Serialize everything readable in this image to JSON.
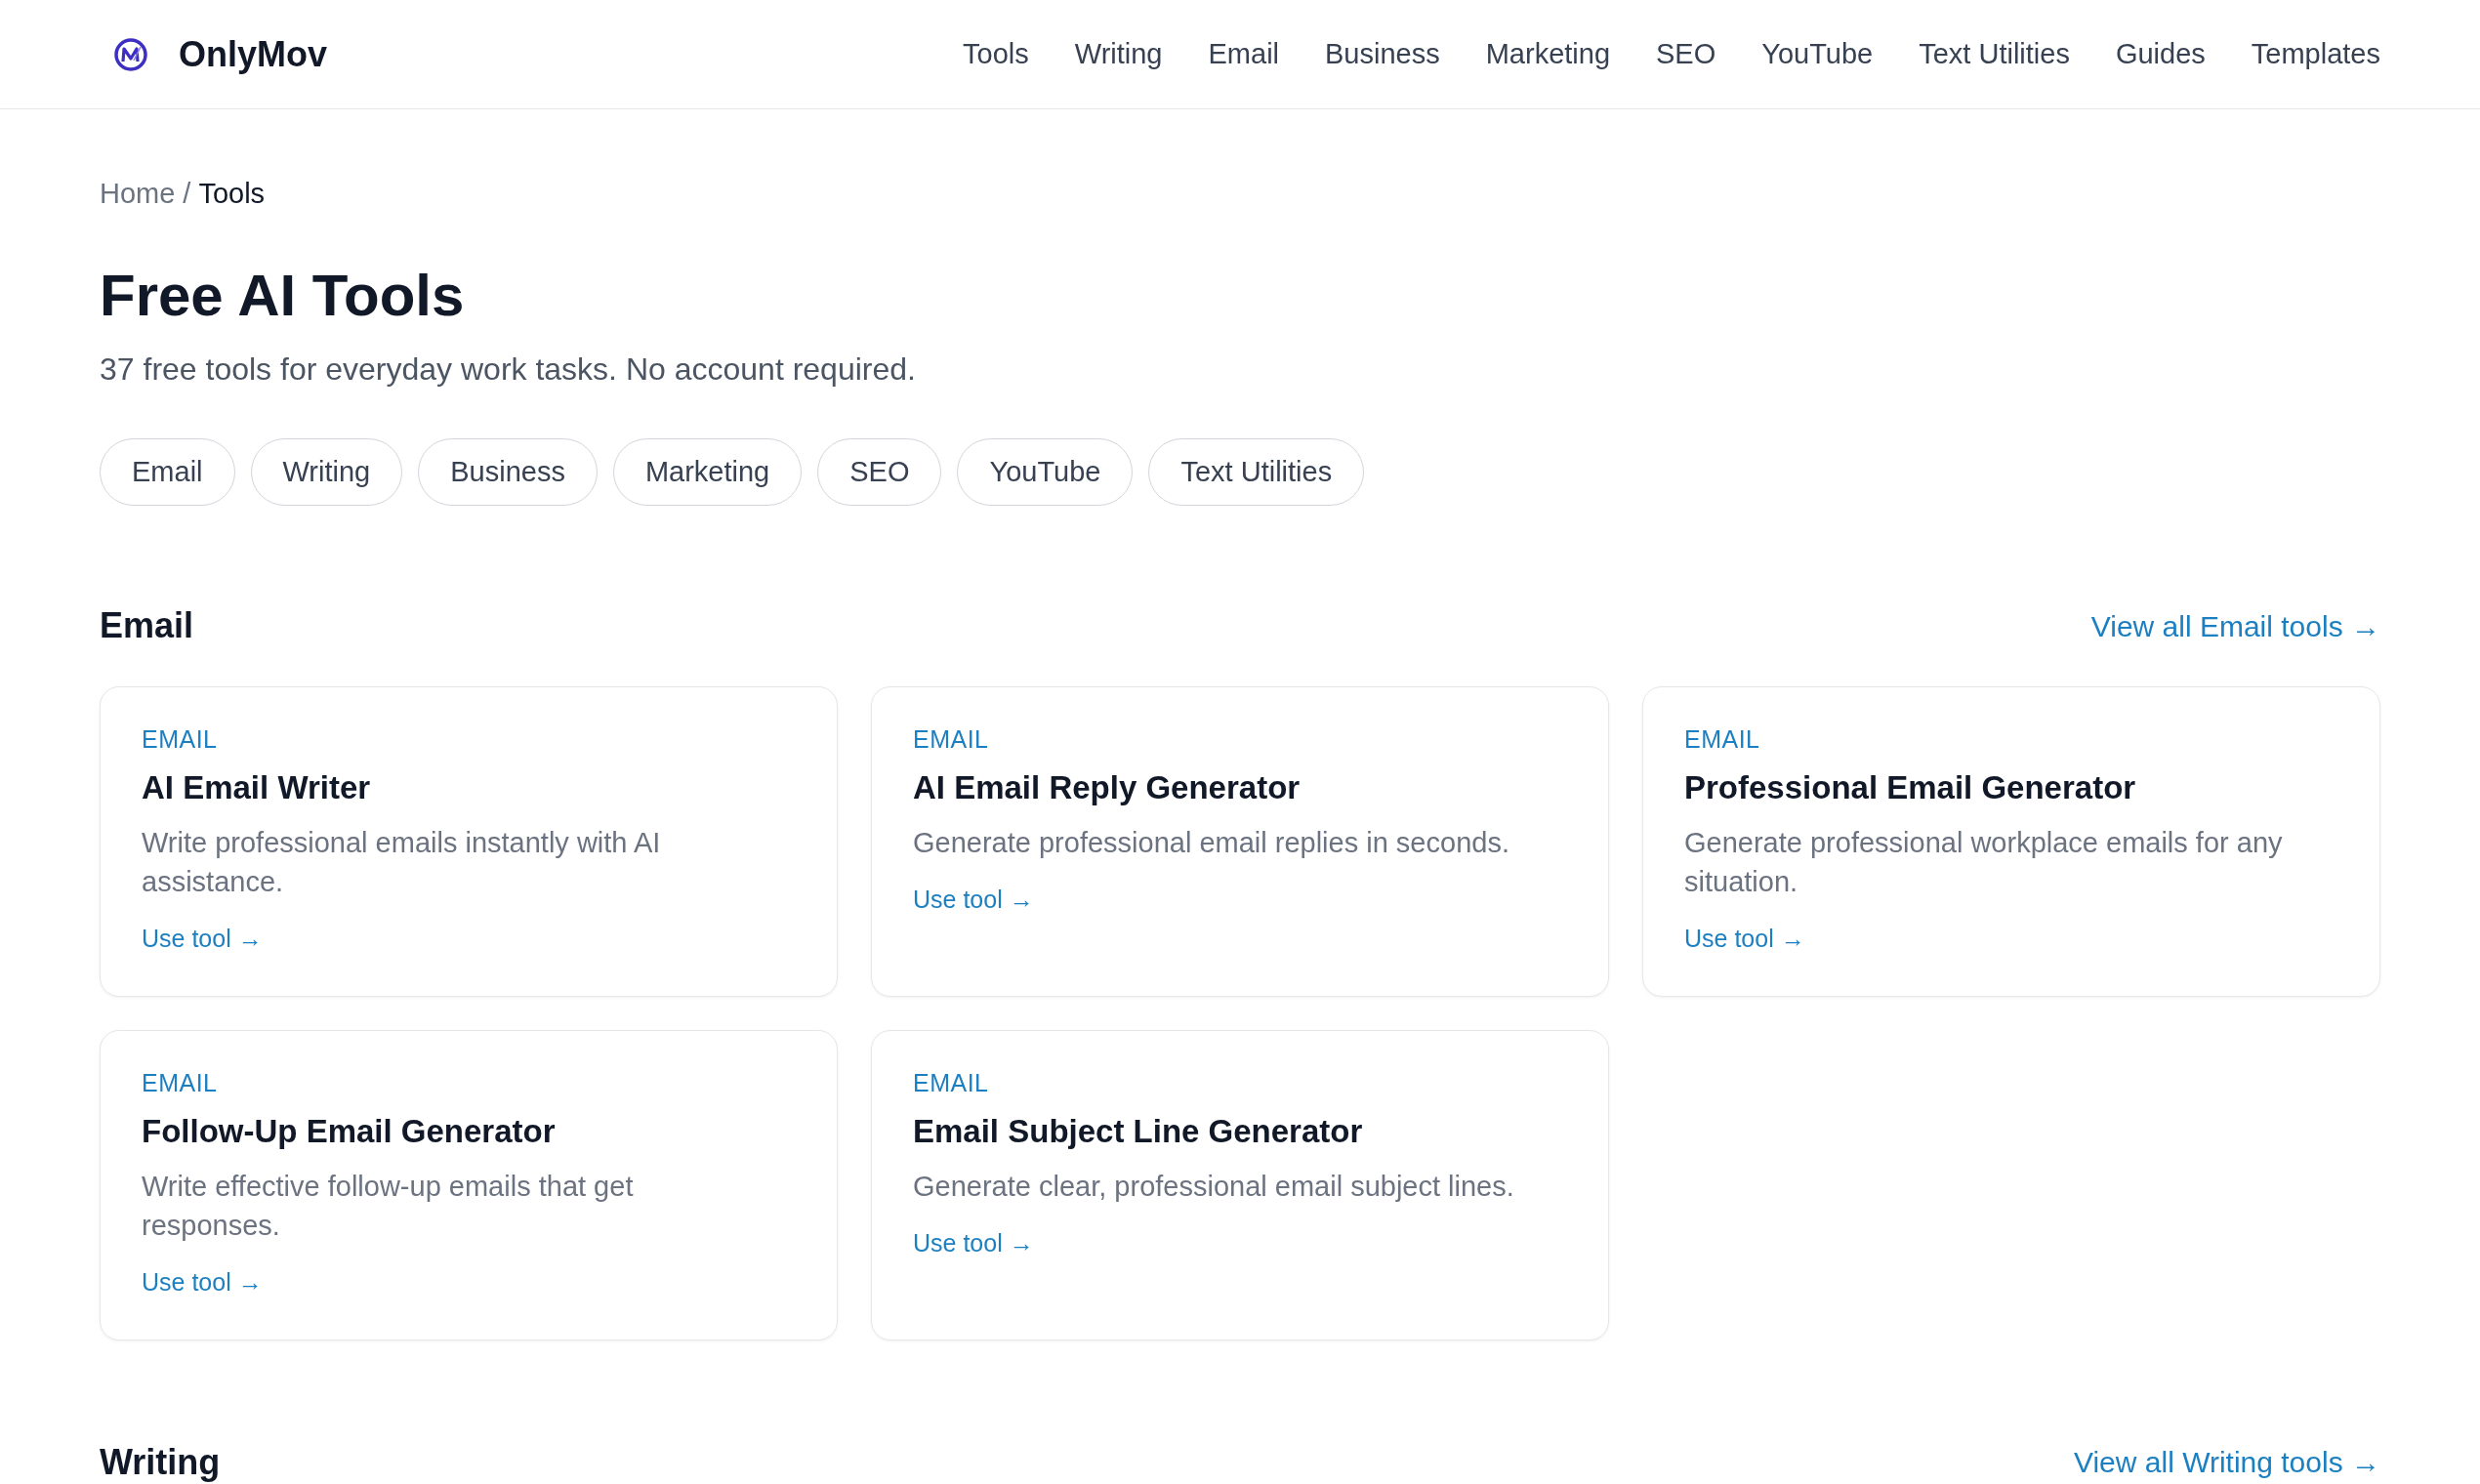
{
  "header": {
    "brand": "OnlyMov",
    "nav": [
      "Tools",
      "Writing",
      "Email",
      "Business",
      "Marketing",
      "SEO",
      "YouTube",
      "Text Utilities",
      "Guides",
      "Templates"
    ]
  },
  "breadcrumb": {
    "separator": "/",
    "items": [
      {
        "label": "Home",
        "current": false
      },
      {
        "label": "Tools",
        "current": true
      }
    ]
  },
  "page": {
    "title": "Free AI Tools",
    "subtitle": "37 free tools for everyday work tasks. No account required."
  },
  "filters": [
    "Email",
    "Writing",
    "Business",
    "Marketing",
    "SEO",
    "YouTube",
    "Text Utilities"
  ],
  "sections": [
    {
      "title": "Email",
      "view_all": "View all Email tools →",
      "tools": [
        {
          "category": "EMAIL",
          "name": "AI Email Writer",
          "description": "Write professional emails instantly with AI assistance.",
          "link": "Use tool →"
        },
        {
          "category": "EMAIL",
          "name": "AI Email Reply Generator",
          "description": "Generate professional email replies in seconds.",
          "link": "Use tool →"
        },
        {
          "category": "EMAIL",
          "name": "Professional Email Generator",
          "description": "Generate professional workplace emails for any situation.",
          "link": "Use tool →"
        },
        {
          "category": "EMAIL",
          "name": "Follow-Up Email Generator",
          "description": "Write effective follow-up emails that get responses.",
          "link": "Use tool →"
        },
        {
          "category": "EMAIL",
          "name": "Email Subject Line Generator",
          "description": "Generate clear, professional email subject lines.",
          "link": "Use tool →"
        }
      ]
    },
    {
      "title": "Writing",
      "view_all": "View all Writing tools →"
    }
  ]
}
